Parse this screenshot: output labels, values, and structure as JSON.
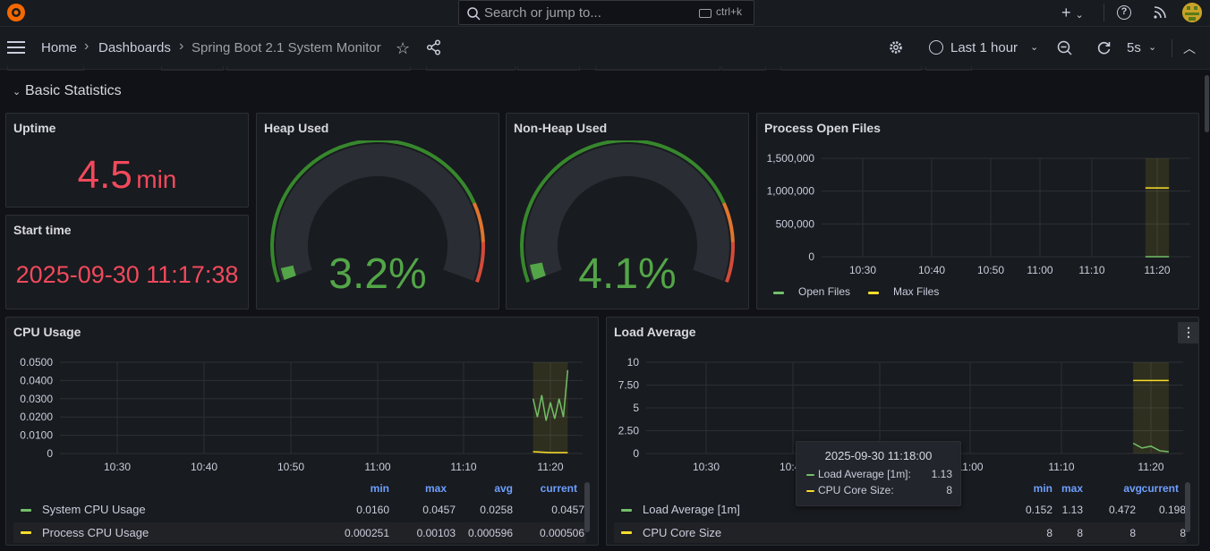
{
  "topbar": {
    "search_placeholder": "Search or jump to...",
    "search_shortcut": "ctrl+k",
    "plus_label": "+"
  },
  "nav": {
    "crumbs": [
      "Home",
      "Dashboards",
      "Spring Boot 2.1 System Monitor"
    ],
    "time_range": "Last 1 hour",
    "refresh_interval": "5s"
  },
  "row": {
    "title": "Basic Statistics"
  },
  "uptime": {
    "title": "Uptime",
    "value": "4.5",
    "unit": "min"
  },
  "start_time": {
    "title": "Start time",
    "value": "2025-09-30 11:17:38"
  },
  "heap": {
    "title": "Heap Used",
    "value": "3.2%",
    "percent": 3.2
  },
  "nonheap": {
    "title": "Non-Heap Used",
    "value": "4.1%",
    "percent": 4.1
  },
  "open_files": {
    "title": "Process Open Files",
    "legend": [
      "Open Files",
      "Max Files"
    ],
    "colors": {
      "open": "#73bf69",
      "max": "#fade2a"
    }
  },
  "cpu": {
    "title": "CPU Usage",
    "headers": [
      "min",
      "max",
      "avg",
      "current"
    ],
    "rows": [
      {
        "name": "System CPU Usage",
        "min": "0.0160",
        "max": "0.0457",
        "avg": "0.0258",
        "current": "0.0457"
      },
      {
        "name": "Process CPU Usage",
        "min": "0.000251",
        "max": "0.00103",
        "avg": "0.000596",
        "current": "0.000506"
      }
    ]
  },
  "load": {
    "title": "Load Average",
    "headers": [
      "min",
      "max",
      "avg",
      "current"
    ],
    "rows": [
      {
        "name": "Load Average [1m]",
        "min": "0.152",
        "max": "1.13",
        "avg": "0.472",
        "current": "0.198"
      },
      {
        "name": "CPU Core Size",
        "min": "8",
        "max": "8",
        "avg": "8",
        "current": "8"
      }
    ]
  },
  "tooltip": {
    "time": "2025-09-30 11:18:00",
    "rows": [
      {
        "name": "Load Average [1m]:",
        "value": "1.13"
      },
      {
        "name": "CPU Core Size:",
        "value": "8"
      }
    ]
  },
  "chart_data": [
    {
      "type": "line",
      "title": "Process Open Files",
      "x_ticks": [
        "10:30",
        "10:40",
        "10:50",
        "11:00",
        "11:10",
        "11:20"
      ],
      "y_ticks": [
        "1,500,000",
        "1,000,000",
        "500,000",
        "0"
      ],
      "ylim": [
        0,
        1500000
      ],
      "series": [
        {
          "name": "Open Files",
          "x": [
            "11:18",
            "11:22"
          ],
          "values": [
            0,
            0
          ]
        },
        {
          "name": "Max Files",
          "x": [
            "11:18",
            "11:22"
          ],
          "values": [
            1048576,
            1048576
          ]
        }
      ]
    },
    {
      "type": "line",
      "title": "CPU Usage",
      "x_ticks": [
        "10:30",
        "10:40",
        "10:50",
        "11:00",
        "11:10",
        "11:20"
      ],
      "y_ticks": [
        "0.0500",
        "0.0400",
        "0.0300",
        "0.0200",
        "0.0100",
        "0"
      ],
      "ylim": [
        0,
        0.05
      ],
      "series": [
        {
          "name": "System CPU Usage",
          "x": [
            "11:18",
            "11:18:30",
            "11:19",
            "11:19:30",
            "11:20",
            "11:20:30",
            "11:21",
            "11:21:30",
            "11:22"
          ],
          "values": [
            0.03,
            0.02,
            0.032,
            0.018,
            0.028,
            0.019,
            0.03,
            0.02,
            0.0457
          ]
        },
        {
          "name": "Process CPU Usage",
          "x": [
            "11:18",
            "11:20",
            "11:22"
          ],
          "values": [
            0.001,
            0.0005,
            0.0005
          ]
        }
      ]
    },
    {
      "type": "line",
      "title": "Load Average",
      "x_ticks": [
        "10:30",
        "10:40",
        "10:50",
        "11:00",
        "11:10",
        "11:20"
      ],
      "y_ticks": [
        "10",
        "7.50",
        "5",
        "2.50",
        "0"
      ],
      "ylim": [
        0,
        10
      ],
      "series": [
        {
          "name": "Load Average [1m]",
          "x": [
            "11:18",
            "11:19",
            "11:20",
            "11:21",
            "11:22"
          ],
          "values": [
            1.13,
            0.6,
            0.8,
            0.3,
            0.198
          ]
        },
        {
          "name": "CPU Core Size",
          "x": [
            "11:18",
            "11:22"
          ],
          "values": [
            8,
            8
          ]
        }
      ]
    }
  ]
}
